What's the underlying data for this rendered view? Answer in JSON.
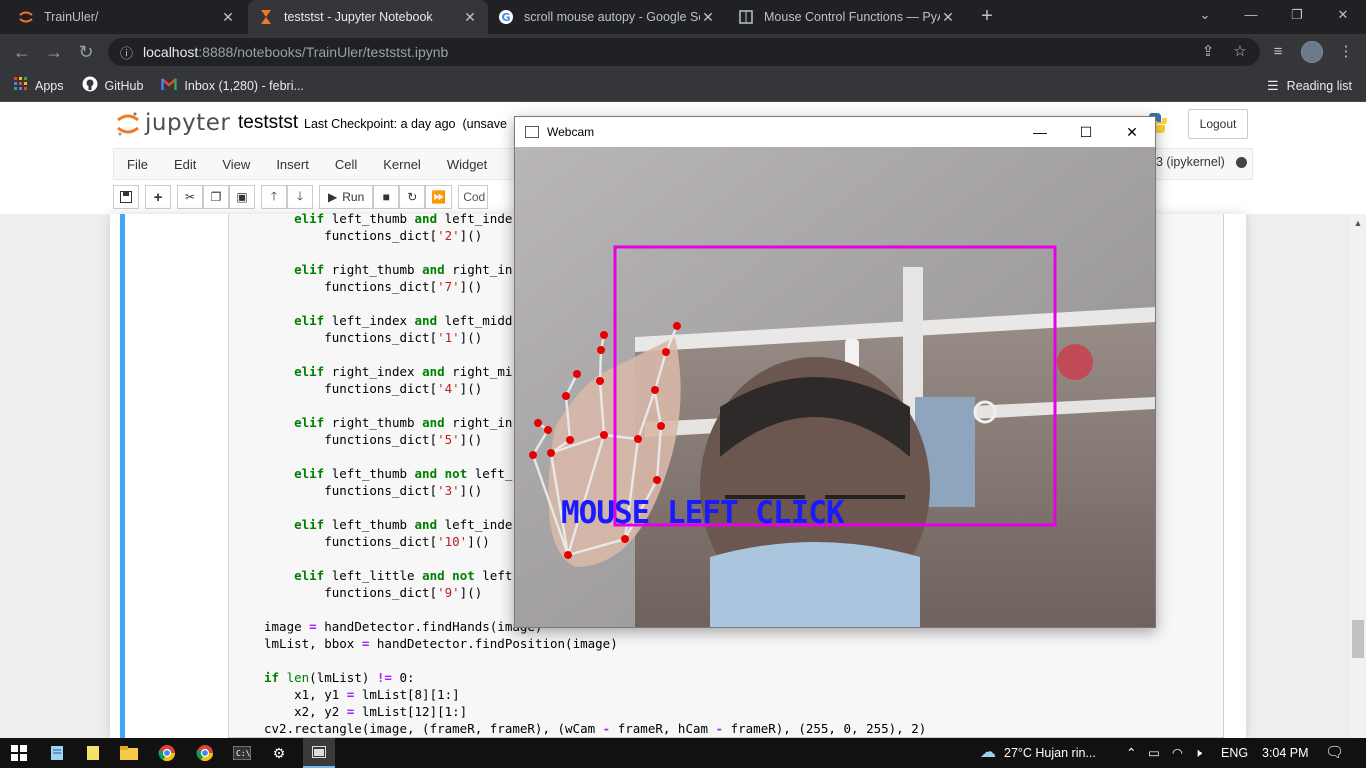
{
  "browser": {
    "tabs": [
      {
        "title": "TrainUler/",
        "icon": "jupyter-icon"
      },
      {
        "title": "teststst - Jupyter Notebook",
        "icon": "hourglass-icon"
      },
      {
        "title": "scroll mouse autopy - Google Se",
        "icon": "google-icon"
      },
      {
        "title": "Mouse Control Functions — PyAu",
        "icon": "doc-icon"
      }
    ],
    "url_host": "localhost",
    "url_path": ":8888/notebooks/TrainUler/teststst.ipynb",
    "bookmarks": [
      {
        "label": "Apps",
        "icon": "apps-grid-icon"
      },
      {
        "label": "GitHub",
        "icon": "github-icon"
      },
      {
        "label": "Inbox (1,280) - febri...",
        "icon": "gmail-icon"
      }
    ],
    "reading_list": "Reading list"
  },
  "jupyter": {
    "logo_text": "jupyter",
    "notebook_name": "teststst",
    "checkpoint": "Last Checkpoint: a day ago",
    "unsaved": "(unsave",
    "logout": "Logout",
    "menu": [
      "File",
      "Edit",
      "View",
      "Insert",
      "Cell",
      "Kernel",
      "Widget"
    ],
    "kernel_name": "3 (ipykernel)",
    "run_label": "Run",
    "cell_type": "Cod"
  },
  "code_lines": [
    "    elif left_thumb and left_inde",
    "        functions_dict['2']()",
    "",
    "    elif right_thumb and right_in",
    "        functions_dict['7']()",
    "",
    "    elif left_index and left_midd",
    "        functions_dict['1']()",
    "",
    "    elif right_index and right_mi",
    "        functions_dict['4']()",
    "",
    "    elif right_thumb and right_in",
    "        functions_dict['5']()",
    "",
    "    elif left_thumb and not left_",
    "        functions_dict['3']()",
    "",
    "    elif left_thumb and left_inde",
    "        functions_dict['10']()",
    "",
    "    elif left_little and not left",
    "        functions_dict['9']()",
    "",
    "image = handDetector.findHands(image)",
    "lmList, bbox = handDetector.findPosition(image)",
    "",
    "if len(lmList) != 0:",
    "    x1, y1 = lmList[8][1:]",
    "    x2, y2 = lmList[12][1:]",
    "cv2.rectangle(image, (frameR, frameR), (wCam - frameR, hCam - frameR), (255, 0, 255), 2)"
  ],
  "webcam": {
    "title": "Webcam",
    "overlay_text": "MOUSE LEFT CLICK",
    "overlay_color": "#1a1aff",
    "frame_color": "#e600e6"
  },
  "taskbar": {
    "weather": "27°C  Hujan rin...",
    "lang": "ENG",
    "time": "3:04 PM"
  }
}
